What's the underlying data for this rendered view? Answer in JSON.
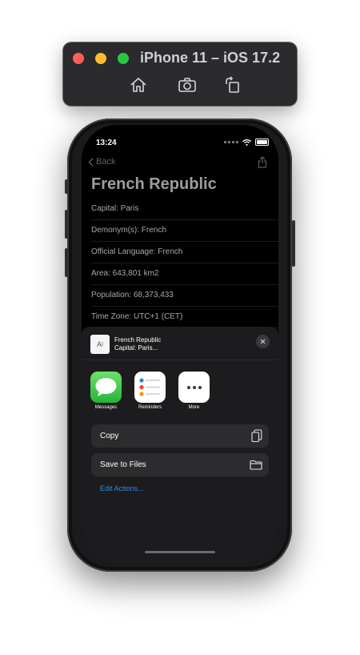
{
  "simulator": {
    "title": "iPhone 11 – iOS 17.2",
    "buttons": [
      "home-icon",
      "screenshot-icon",
      "rotate-icon"
    ]
  },
  "status_bar": {
    "time": "13:24"
  },
  "nav": {
    "back_label": "Back"
  },
  "page": {
    "title": "French Republic",
    "rows": [
      "Capital: Paris",
      "Demonym(s): French",
      "Official Language: French",
      "Area: 643,801 km2",
      "Population: 68,373,433",
      "Time Zone: UTC+1 (CET)"
    ]
  },
  "share_sheet": {
    "preview_title": "French Republic",
    "preview_subtitle": "Capital: Paris...",
    "apps": [
      "Messages",
      "Reminders",
      "More"
    ],
    "actions": [
      "Copy",
      "Save to Files"
    ],
    "edit_actions": "Edit Actions..."
  },
  "colors": {
    "link": "#2f8cf5",
    "sheet_bg": "#1c1c1e",
    "action_bg": "#2c2c2e"
  }
}
